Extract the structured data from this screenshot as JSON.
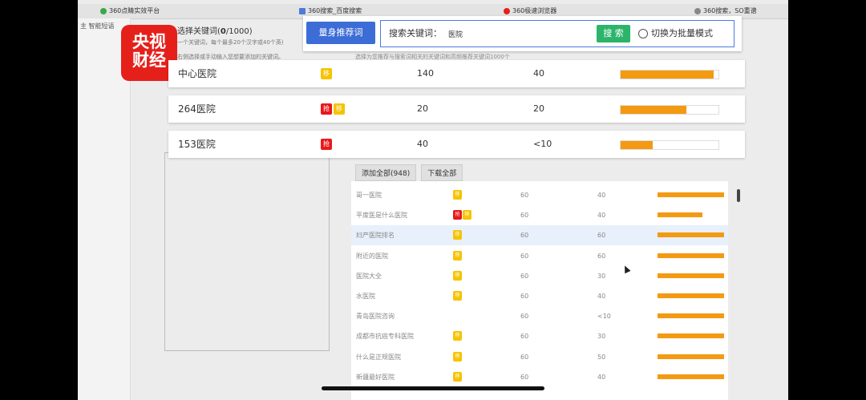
{
  "browser_tabs": [
    {
      "label": "360点睛实效平台",
      "icon_color": "#3aa84a"
    },
    {
      "label": "360搜索_百度搜索",
      "icon_color": "#4a7cdc"
    },
    {
      "label": "360极速浏览器",
      "icon_color": "#e5201b"
    },
    {
      "label": "360搜索，SO重谱",
      "icon_color": "#888888"
    }
  ],
  "sidebar": {
    "item": "主 智能短语"
  },
  "logo": {
    "line1": "央视",
    "line2": "财经"
  },
  "selection": {
    "title_prefix": "选择关键词(",
    "count": "0",
    "title_suffix": "/1000)",
    "hint1": "一个关键词，每个最多20个汉字或40个英)",
    "hint2": "右侧选择或手动输入您想要添加的关键词。"
  },
  "search": {
    "tag_button": "量身推荐词",
    "label": "搜索关键词：",
    "value": "医院",
    "button": "搜 索",
    "mode_switch": "切换为批量模式"
  },
  "section_note": "选择为您推荐与搜索词相关的关键词和高频推荐关键词1000个",
  "featured_rows": [
    {
      "keyword": "中心医院",
      "badges": [
        "移"
      ],
      "v1": "140",
      "v2": "40",
      "level": 0.95
    },
    {
      "keyword": "264医院",
      "badges": [
        "抢",
        "移"
      ],
      "v1": "20",
      "v2": "20",
      "level": 0.67
    },
    {
      "keyword": "153医院",
      "badges": [
        "抢"
      ],
      "v1": "40",
      "v2": "<10",
      "level": 0.33
    }
  ],
  "actions": {
    "add_all": "添加全部(948)",
    "download_all": "下载全部"
  },
  "list_rows": [
    {
      "keyword": "哥一医院",
      "badges": [
        "移"
      ],
      "v1": "60",
      "v2": "40",
      "level": 1.0
    },
    {
      "keyword": "平度医是什么医院",
      "badges": [
        "抢",
        "移"
      ],
      "v1": "60",
      "v2": "40",
      "level": 0.67
    },
    {
      "keyword": "妇产医院排名",
      "badges": [
        "移"
      ],
      "v1": "60",
      "v2": "60",
      "level": 1.0
    },
    {
      "keyword": "附近的医院",
      "badges": [
        "移"
      ],
      "v1": "60",
      "v2": "60",
      "level": 1.0
    },
    {
      "keyword": "医院大全",
      "badges": [
        "移"
      ],
      "v1": "60",
      "v2": "30",
      "level": 1.0
    },
    {
      "keyword": "水医院",
      "badges": [
        "移"
      ],
      "v1": "60",
      "v2": "40",
      "level": 1.0
    },
    {
      "keyword": "青岛医院咨询",
      "badges": [],
      "v1": "60",
      "v2": "<10",
      "level": 1.0
    },
    {
      "keyword": "成都市抗癌专科医院",
      "badges": [
        "移"
      ],
      "v1": "60",
      "v2": "30",
      "level": 1.0
    },
    {
      "keyword": "什么是正规医院",
      "badges": [
        "移"
      ],
      "v1": "60",
      "v2": "50",
      "level": 1.0
    },
    {
      "keyword": "新疆最好医院",
      "badges": [
        "移"
      ],
      "v1": "60",
      "v2": "40",
      "level": 1.0
    }
  ]
}
